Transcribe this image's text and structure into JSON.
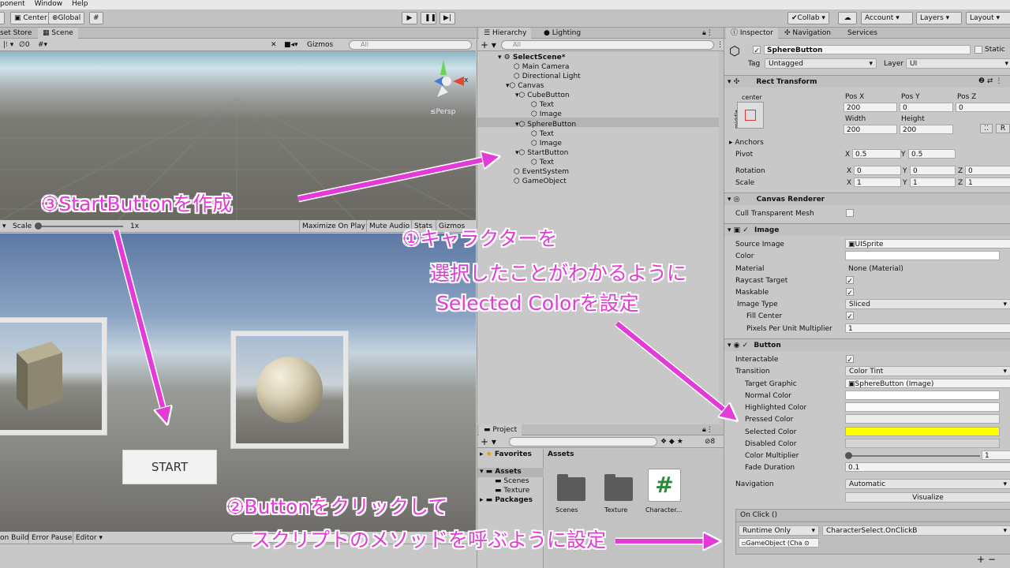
{
  "menu": [
    "ponent",
    "Window",
    "Help"
  ],
  "toolbar": {
    "center": "Center",
    "global": "Global",
    "collab": "Collab ▾",
    "account": "Account",
    "layers": "Layers",
    "layout": "Layout"
  },
  "scene": {
    "tab_asset_store": "set Store",
    "tab_scene": "Scene",
    "gizmos": "Gizmos",
    "search": "All",
    "hidden_count": "0",
    "persp": "≤Persp",
    "axis_x": "x"
  },
  "game": {
    "scale_label": "Scale",
    "scale_value": "1x",
    "maximize": "Maximize On Play",
    "mute": "Mute Audio",
    "stats": "Stats",
    "gizmos": "Gizmos",
    "start_label": "START"
  },
  "hierarchy": {
    "tab": "Hierarchy",
    "lighting": "Lighting",
    "search": "All",
    "items": [
      "SelectScene*",
      "Main Camera",
      "Directional Light",
      "Canvas",
      "CubeButton",
      "Text",
      "Image",
      "SphereButton",
      "Text",
      "Image",
      "StartButton",
      "Text",
      "EventSystem",
      "GameObject"
    ]
  },
  "project": {
    "tab": "Project",
    "count": "8",
    "favorites": "Favorites",
    "assets": "Assets",
    "scenes": "Scenes",
    "texture": "Texture",
    "packages": "Packages",
    "assets_header": "Assets",
    "files": [
      "Scenes",
      "Texture",
      "Character..."
    ]
  },
  "console": {
    "build": "on Build",
    "error_pause": "Error Pause",
    "editor": "Editor"
  },
  "inspector": {
    "tab": "Inspector",
    "navigation_tab": "Navigation",
    "services_tab": "Services",
    "name": "SphereButton",
    "static": "Static",
    "tag_label": "Tag",
    "tag": "Untagged",
    "layer_label": "Layer",
    "layer": "UI",
    "rect": {
      "title": "Rect Transform",
      "center": "center",
      "middle": "middle",
      "posx": "Pos X",
      "posy": "Pos Y",
      "posz": "Pos Z",
      "vx": "200",
      "vy": "0",
      "vz": "0",
      "width": "Width",
      "height": "Height",
      "w": "200",
      "h": "200",
      "anchors": "Anchors",
      "pivot": "Pivot",
      "px": "0.5",
      "py": "0.5",
      "rotation": "Rotation",
      "rx": "0",
      "ry": "0",
      "rz": "0",
      "scale": "Scale",
      "sx": "1",
      "sy": "1",
      "sz": "1",
      "x": "X",
      "y": "Y",
      "z": "Z",
      "r": "R"
    },
    "canvas_renderer": "Canvas Renderer",
    "cull": "Cull Transparent Mesh",
    "image": {
      "title": "Image",
      "source_label": "Source Image",
      "source": "UISprite",
      "color": "Color",
      "material_label": "Material",
      "material": "None (Material)",
      "raycast": "Raycast Target",
      "maskable": "Maskable",
      "type_label": "Image Type",
      "type": "Sliced",
      "fill": "Fill Center",
      "ppu_label": "Pixels Per Unit Multiplier",
      "ppu": "1"
    },
    "button": {
      "title": "Button",
      "interactable": "Interactable",
      "transition_label": "Transition",
      "transition": "Color Tint",
      "target_label": "Target Graphic",
      "target": "SphereButton (Image)",
      "normal": "Normal Color",
      "highlighted": "Highlighted Color",
      "pressed": "Pressed Color",
      "selected": "Selected Color",
      "disabled": "Disabled Color",
      "multiplier": "Color Multiplier",
      "multiplier_value": "1",
      "fade": "Fade Duration",
      "fade_value": "0.1",
      "navigation_label": "Navigation",
      "navigation": "Automatic",
      "visualize": "Visualize",
      "onclick": "On Click ()",
      "runtime": "Runtime Only",
      "method": "CharacterSelect.OnClickB",
      "object": "GameObject (Cha"
    },
    "selected_color_hex": "#ffff00"
  },
  "annotations": {
    "a3": "③StartButtonを作成",
    "a1_line1": "①キャラクターを",
    "a1_line2": "選択したことがわかるように",
    "a1_line3": "Selected Colorを設定",
    "a2_line1": "②Buttonをクリックして",
    "a2_line2": "スクリプトのメソッドを呼ぶように設定"
  },
  "colors": {
    "annotation": "#e23bd8"
  }
}
